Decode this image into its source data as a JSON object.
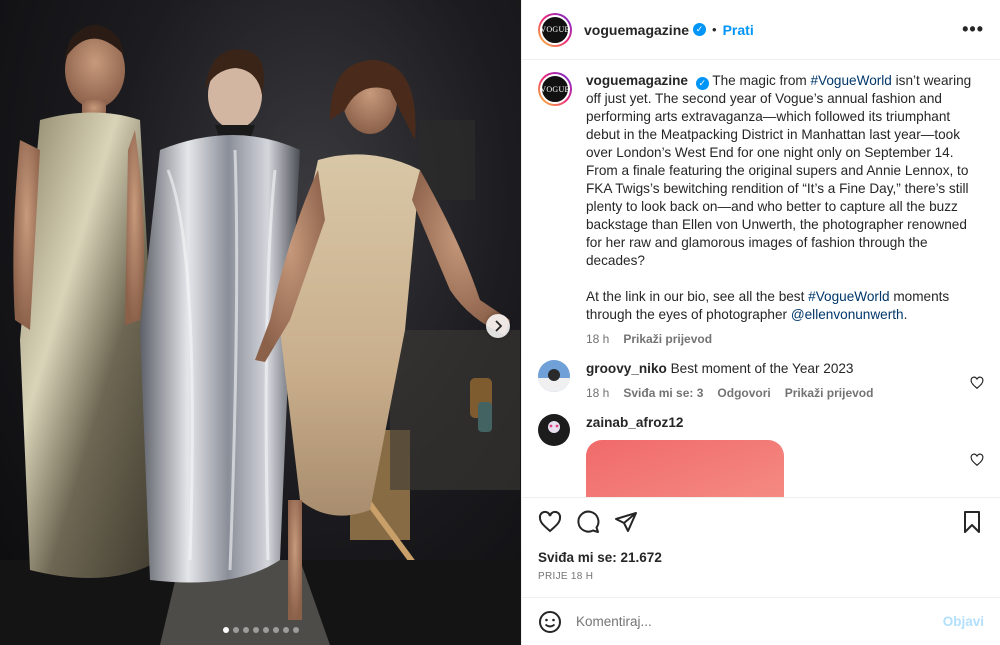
{
  "post": {
    "image_alt": "Three women in metallic gowns backstage",
    "carousel": {
      "count": 8,
      "active_index": 0
    }
  },
  "header": {
    "username": "voguemagazine",
    "avatar_text": "VOGUE",
    "separator": "•",
    "follow_label": "Prati",
    "more_label": "•••"
  },
  "caption": {
    "username": "voguemagazine",
    "p1_a": " The magic from ",
    "p1_link1": "#VogueWorld",
    "p1_b": " isn’t wearing off just yet. The second year of Vogue’s annual fashion and performing arts extravaganza—which followed its triumphant debut in the Meatpacking District in Manhattan last year—took over London’s West End for one night only on September 14. From a finale featuring the original supers and Annie Lennox, to FKA Twigs’s bewitching rendition of “It’s a Fine Day,” there’s still plenty to look back on—and who better to capture all the buzz backstage than Ellen von Unwerth, the photographer renowned for her raw and glamorous images of fashion through the decades?",
    "p2_a": "At the link in our bio, see all the best ",
    "p2_link1": "#VogueWorld",
    "p2_b": " moments through the eyes of photographer ",
    "p2_link2": "@ellenvonunwerth",
    "p2_c": ".",
    "time": "18 h",
    "translate_label": "Prikaži prijevod"
  },
  "comments": [
    {
      "username": "groovy_niko",
      "text": "Best moment of the Year 2023",
      "time": "18 h",
      "likes_label": "Sviđa mi se: 3",
      "reply_label": "Odgovori",
      "translate_label": "Prikaži prijevod"
    },
    {
      "username": "zainab_afroz12",
      "text": ""
    }
  ],
  "actions": {
    "likes_text": "Sviđa mi se: 21.672",
    "time_ago": "PRIJE 18 H"
  },
  "composer": {
    "placeholder": "Komentiraj...",
    "post_label": "Objavi"
  },
  "colors": {
    "accent": "#0095f6",
    "link": "#00376b",
    "muted": "#737373",
    "disabled_post": "#b2dffc"
  }
}
